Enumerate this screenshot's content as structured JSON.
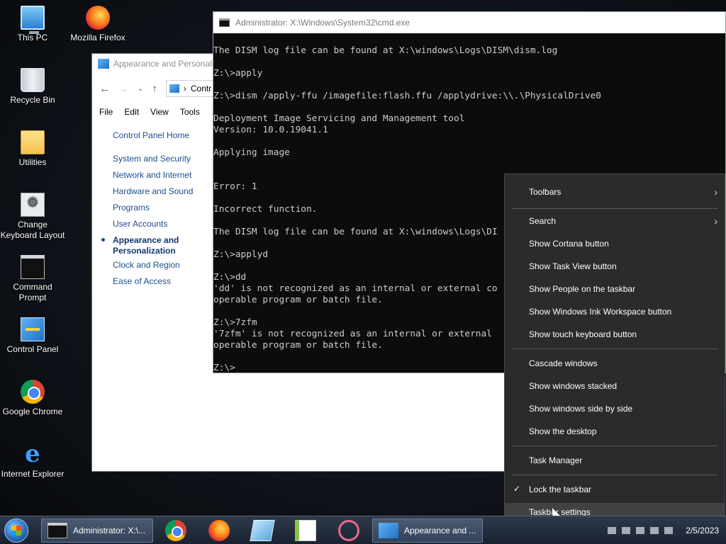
{
  "desktop": {
    "icons": [
      {
        "label": "This PC"
      },
      {
        "label": "Mozilla Firefox"
      },
      {
        "label": "Recycle Bin"
      },
      {
        "label": "Utilities"
      },
      {
        "label": "Change Keyboard Layout"
      },
      {
        "label": "Command Prompt"
      },
      {
        "label": "Control Panel"
      },
      {
        "label": "Google Chrome"
      },
      {
        "label": "Internet Explorer"
      }
    ]
  },
  "control_panel": {
    "title": "Appearance and Personaliz",
    "address": "Contr",
    "menu": [
      "File",
      "Edit",
      "View",
      "Tools"
    ],
    "sidebar": [
      "Control Panel Home",
      "System and Security",
      "Network and Internet",
      "Hardware and Sound",
      "Programs",
      "User Accounts",
      "Appearance and Personalization",
      "Clock and Region",
      "Ease of Access"
    ]
  },
  "cmd": {
    "title": "Administrator: X:\\Windows\\System32\\cmd.exe",
    "lines": [
      "The DISM log file can be found at X:\\windows\\Logs\\DISM\\dism.log",
      "",
      "Z:\\>apply",
      "",
      "Z:\\>dism /apply-ffu /imagefile:flash.ffu /applydrive:\\\\.\\PhysicalDrive0",
      "",
      "Deployment Image Servicing and Management tool",
      "Version: 10.0.19041.1",
      "",
      "Applying image",
      "",
      "",
      "Error: 1",
      "",
      "Incorrect function.",
      "",
      "The DISM log file can be found at X:\\windows\\Logs\\DI",
      "",
      "Z:\\>applyd",
      "",
      "Z:\\>dd",
      "'dd' is not recognized as an internal or external co",
      "operable program or batch file.",
      "",
      "Z:\\>7zfm",
      "'7zfm' is not recognized as an internal or external",
      "operable program or batch file.",
      "",
      "Z:\\>"
    ]
  },
  "context_menu": {
    "toolbars": "Toolbars",
    "search": "Search",
    "show_cortana": "Show Cortana button",
    "show_task_view": "Show Task View button",
    "show_people": "Show People on the taskbar",
    "show_ink": "Show Windows Ink Workspace button",
    "show_touch_kb": "Show touch keyboard button",
    "cascade": "Cascade windows",
    "stacked": "Show windows stacked",
    "side_by_side": "Show windows side by side",
    "show_desktop": "Show the desktop",
    "task_manager": "Task Manager",
    "lock_taskbar": "Lock the taskbar",
    "taskbar_settings": "Taskbar settings",
    "lock_checked_glyph": "✓",
    "submenu_arrow": "›"
  },
  "taskbar": {
    "cmd_button": "Administrator: X:\\...",
    "cp_button": "Appearance and ...",
    "date": "2/5/2023"
  }
}
